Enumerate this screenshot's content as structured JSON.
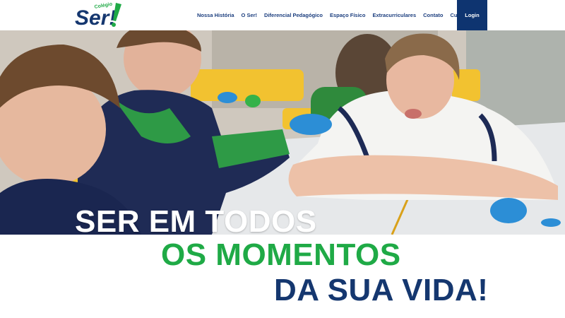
{
  "brand": {
    "logo_text": "Ser!",
    "logo_small": "Colégio",
    "colors": {
      "navy": "#15376f",
      "green": "#1faa46",
      "white": "#ffffff"
    }
  },
  "nav": {
    "items": [
      {
        "label": "Nossa História"
      },
      {
        "label": "O Ser!"
      },
      {
        "label": "Diferencial Pedagógico"
      },
      {
        "label": "Espaço Físico"
      },
      {
        "label": "Extracurriculares"
      },
      {
        "label": "Contato"
      },
      {
        "label": "Cursinho"
      }
    ],
    "login_label": "Login"
  },
  "hero": {
    "headline_line1": "SER EM TODOS",
    "headline_line2": "OS MOMENTOS",
    "headline_line3": "DA SUA VIDA!"
  }
}
